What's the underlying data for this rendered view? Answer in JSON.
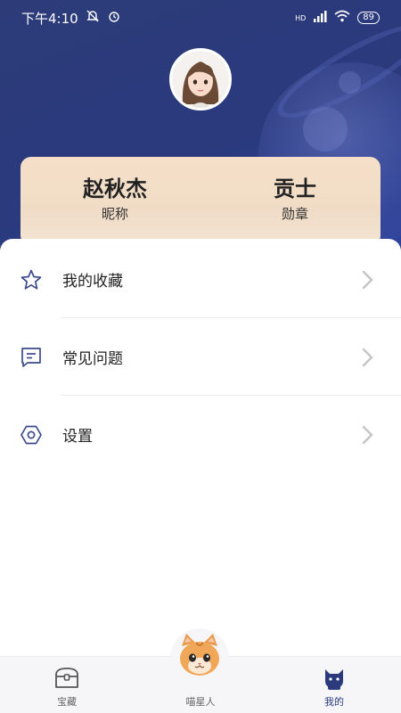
{
  "status_bar": {
    "time": "下午4:10",
    "network": "HD",
    "battery": "89"
  },
  "profile": {
    "nickname_value": "赵秋杰",
    "nickname_label": "昵称",
    "badge_value": "贡士",
    "badge_label": "勋章"
  },
  "menu": {
    "items": [
      {
        "label": "我的收藏",
        "icon": "star-icon"
      },
      {
        "label": "常见问题",
        "icon": "message-icon"
      },
      {
        "label": "设置",
        "icon": "settings-icon"
      }
    ]
  },
  "tabbar": {
    "items": [
      {
        "label": "宝藏",
        "icon": "treasure-chest-icon"
      },
      {
        "label": "喵星人",
        "icon": "cat-face-icon"
      },
      {
        "label": "我的",
        "icon": "cat-silhouette-icon"
      }
    ],
    "active_index": 2
  },
  "colors": {
    "header": "#2a3a7d",
    "card": "#f4e0cb",
    "active_tab": "#2a3a7d"
  }
}
